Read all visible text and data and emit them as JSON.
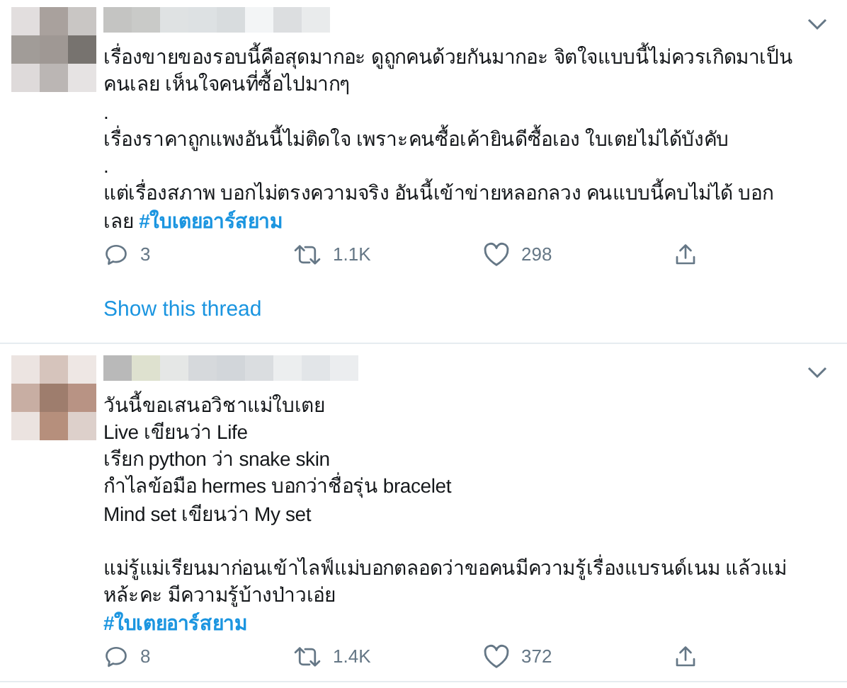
{
  "tweets": [
    {
      "paragraphs": [
        [
          {
            "text": "เรื่องขายของรอบนี้คือสุดมากอะ ดูถูกคนด้วยกันมากอะ จิตใจแบบนี้ไม่ควรเกิดมาเป็น"
          },
          {
            "text": "คนเลย เห็นใจคนที่ซื้อไปมากๆ"
          },
          {
            "text": "."
          },
          {
            "text": "เรื่องราคาถูกแพงอันนี้ไม่ติดใจ เพราะคนซื้อเค้ายินดีซื้อเอง ใบเตยไม่ได้บังคับ"
          },
          {
            "text": "."
          },
          {
            "text": "แต่เรื่องสภาพ บอกไม่ตรงความจริง อันนี้เข้าข่ายหลอกลวง คนแบบนี้คบไม่ได้ บอก"
          },
          {
            "text": "เลย",
            "hashtag": "#ใบเตยอาร์สยาม"
          }
        ]
      ],
      "replies": "3",
      "retweets": "1.1K",
      "likes": "298",
      "show_thread": "Show this thread"
    },
    {
      "paragraphs": [
        [
          {
            "text": "วันนี้ขอเสนอวิชาแม่ใบเตย"
          },
          {
            "text": "Live เขียนว่า Life"
          },
          {
            "text": "เรียก python ว่า snake skin"
          },
          {
            "text": "กำไลข้อมือ hermes บอกว่าชื่อรุ่น bracelet"
          },
          {
            "text": "Mind set เขียนว่า My set"
          }
        ],
        [
          {
            "text": "แม่รู้แม่เรียนมาก่อนเข้าไลฟ์แม่บอกตลอดว่าขอคนมีความรู้เรื่องแบรนด์เนม แล้วแม่"
          },
          {
            "text": "หล้ะคะ มีความรู้บ้างป่าวเอ่ย"
          },
          {
            "hashtag": "#ใบเตยอาร์สยาม"
          }
        ]
      ],
      "replies": "8",
      "retweets": "1.4K",
      "likes": "372"
    }
  ]
}
